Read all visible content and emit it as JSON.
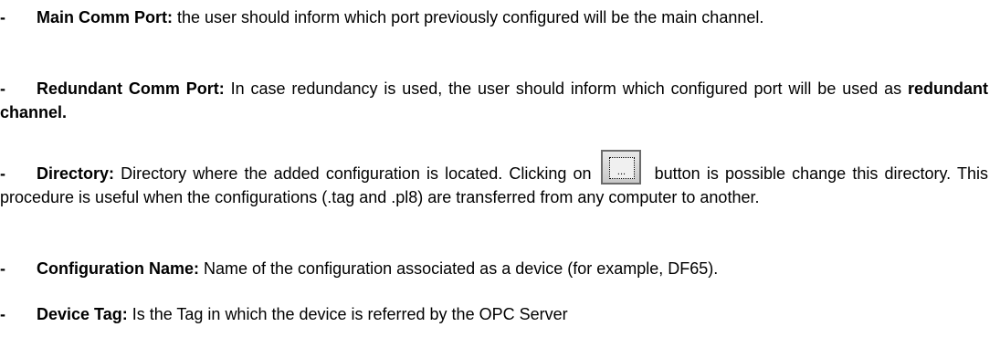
{
  "items": [
    {
      "bullet": "-",
      "term": "Main Comm Port:",
      "text_before": " the user should inform which port previously configured will be the main channel."
    },
    {
      "bullet": "-",
      "term": "Redundant Comm Port:",
      "text_before": " In case redundancy is used, the user should inform which configured port will be used as ",
      "emphasis": "redundant channel."
    },
    {
      "bullet": "-",
      "term": "Directory:",
      "text_before": " Directory where the added configuration is located. Clicking on",
      "button_glyph": "...",
      "text_after": " button is possible change this directory. This procedure is useful when the configurations (.tag and .pl8) are transferred from any computer to another."
    },
    {
      "bullet": "-",
      "term": "Configuration Name:",
      "text_before": " Name of the configuration associated as a device (for example, DF65)."
    },
    {
      "bullet": "-",
      "term": "Device Tag:",
      "text_before": " Is the Tag in which the device is referred by the OPC Server"
    }
  ]
}
